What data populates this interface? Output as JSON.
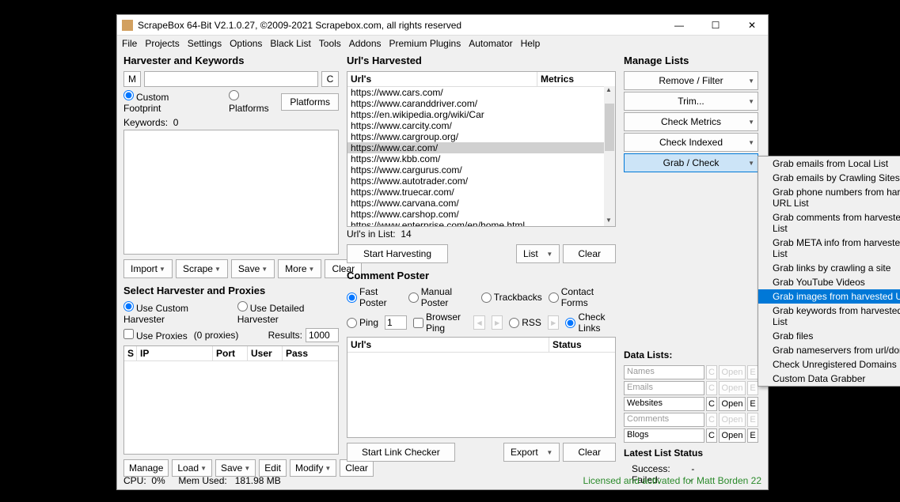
{
  "window": {
    "title": "ScrapeBox 64-Bit V2.1.0.27, ©2009-2021 Scrapebox.com, all rights reserved",
    "min": "—",
    "max": "☐",
    "close": "✕"
  },
  "menu": [
    "File",
    "Projects",
    "Settings",
    "Options",
    "Black List",
    "Tools",
    "Addons",
    "Premium Plugins",
    "Automator",
    "Help"
  ],
  "harvester": {
    "title": "Harvester and Keywords",
    "m_btn": "M",
    "c_btn": "C",
    "custom_footprint": "Custom Footprint",
    "platforms_radio": "Platforms",
    "platforms_btn": "Platforms",
    "keywords_label": "Keywords:",
    "keywords_count": "0",
    "buttons": {
      "import": "Import",
      "scrape": "Scrape",
      "save": "Save",
      "more": "More",
      "clear": "Clear"
    }
  },
  "urls_harvested": {
    "title": "Url's Harvested",
    "col_urls": "Url's",
    "col_metrics": "Metrics",
    "items": [
      "https://www.cars.com/",
      "https://www.caranddriver.com/",
      "https://en.wikipedia.org/wiki/Car",
      "https://www.carcity.com/",
      "https://www.cargroup.org/",
      "https://www.car.com/",
      "https://www.kbb.com/",
      "https://www.cargurus.com/",
      "https://www.autotrader.com/",
      "https://www.truecar.com/",
      "https://www.carvana.com/",
      "https://www.carshop.com/",
      "https://www.enterprise.com/en/home.html"
    ],
    "selected_index": 5,
    "count_label": "Url's in List:",
    "count_val": "14",
    "buttons": {
      "start": "Start Harvesting",
      "list": "List",
      "clear": "Clear"
    }
  },
  "manage_lists": {
    "title": "Manage Lists",
    "buttons": [
      "Remove / Filter",
      "Trim...",
      "Check Metrics",
      "Check Indexed",
      "Grab / Check"
    ]
  },
  "dropdown": {
    "items": [
      "Grab emails from Local List",
      "Grab emails by Crawling Sites",
      "Grab phone numbers from harvested URL List",
      "Grab comments from harvested URL List",
      "Grab META info from harvested URL List",
      "Grab links by crawling a site",
      "Grab YouTube Videos",
      "Grab images from harvested URL List",
      "Grab keywords from harvested URL List",
      "Grab files",
      "Grab nameservers from url/domain list",
      "Check Unregistered Domains",
      "Custom Data Grabber"
    ],
    "highlighted": 7,
    "submenu_at": 12
  },
  "proxies": {
    "title": "Select Harvester and Proxies",
    "use_custom": "Use Custom Harvester",
    "use_detailed": "Use Detailed Harvester",
    "use_proxies": "Use Proxies",
    "proxies_count": "(0 proxies)",
    "results_label": "Results:",
    "results_val": "1000",
    "cols": {
      "s": "S",
      "ip": "IP",
      "port": "Port",
      "user": "User",
      "pass": "Pass"
    },
    "buttons": {
      "manage": "Manage",
      "load": "Load",
      "save": "Save",
      "edit": "Edit",
      "modify": "Modify",
      "clear": "Clear"
    }
  },
  "comment": {
    "title": "Comment Poster",
    "fast": "Fast Poster",
    "manual": "Manual Poster",
    "trackbacks": "Trackbacks",
    "contact": "Contact Forms",
    "ping": "Ping",
    "ping_val": "1",
    "browser_ping": "Browser Ping",
    "rss": "RSS",
    "check_links": "Check Links",
    "col_urls": "Url's",
    "col_status": "Status",
    "buttons": {
      "start": "Start Link Checker",
      "export": "Export",
      "clear": "Clear"
    }
  },
  "data_lists": {
    "title": "Data Lists:",
    "rows": [
      {
        "label": "Names",
        "active": false
      },
      {
        "label": "Emails",
        "active": false
      },
      {
        "label": "Websites",
        "active": true
      },
      {
        "label": "Comments",
        "active": false
      },
      {
        "label": "Blogs",
        "active": true
      }
    ],
    "c": "C",
    "open": "Open",
    "e": "E"
  },
  "latest_status": {
    "title": "Latest List Status",
    "success_label": "Success:",
    "success_val": "-",
    "failed_label": "Failed:",
    "failed_val": "-"
  },
  "footer": {
    "cpu_label": "CPU:",
    "cpu": "0%",
    "mem_label": "Mem Used:",
    "mem": "181.98 MB",
    "license": "Licensed and activated for Matt Borden 22"
  }
}
